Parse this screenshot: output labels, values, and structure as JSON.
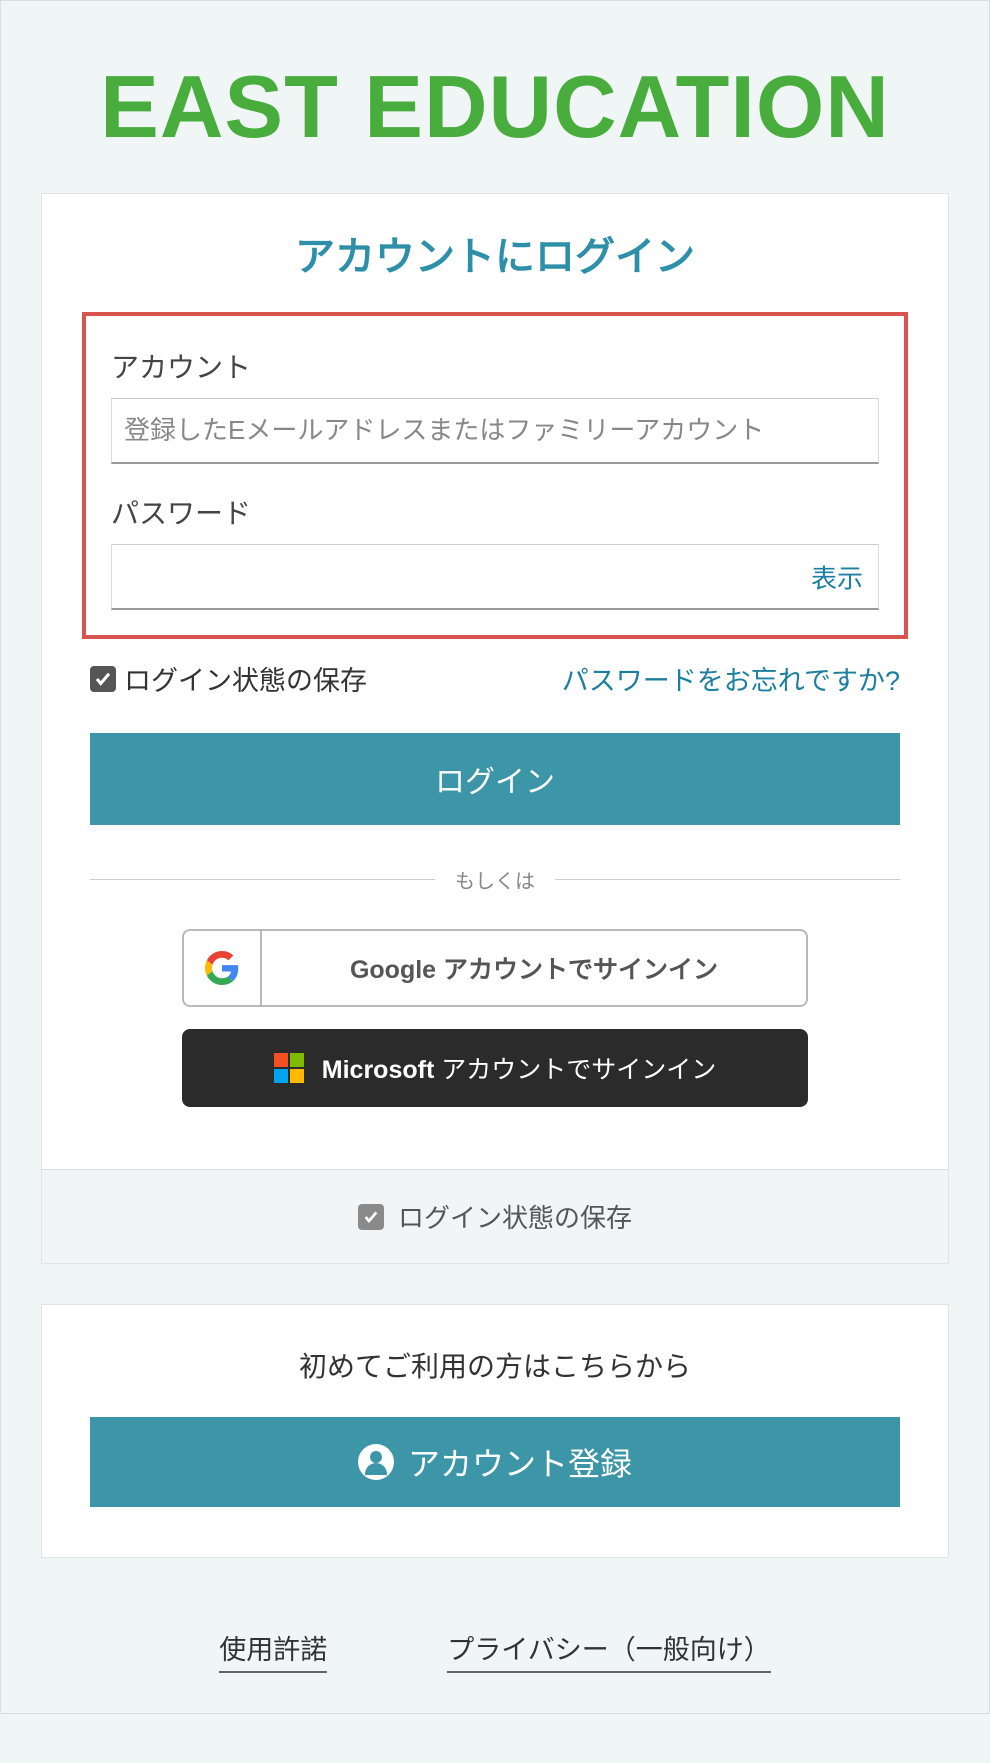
{
  "brand": {
    "title": "EAST EDUCATION"
  },
  "login": {
    "heading": "アカウントにログイン",
    "account_label": "アカウント",
    "account_placeholder": "登録したEメールアドレスまたはファミリーアカウント",
    "password_label": "パスワード",
    "show_password": "表示",
    "remember_label": "ログイン状態の保存",
    "forgot_link": "パスワードをお忘れですか?",
    "submit": "ログイン",
    "divider": "もしくは",
    "google_label": "Google アカウントでサインイン",
    "ms_brand": "Microsoft",
    "ms_rest": " アカウントでサインイン",
    "bottom_remember": "ログイン状態の保存"
  },
  "register": {
    "prompt": "初めてご利用の方はこちらから",
    "button": "アカウント登録"
  },
  "footer": {
    "terms": "使用許諾",
    "privacy": "プライバシー（一般向け）"
  }
}
